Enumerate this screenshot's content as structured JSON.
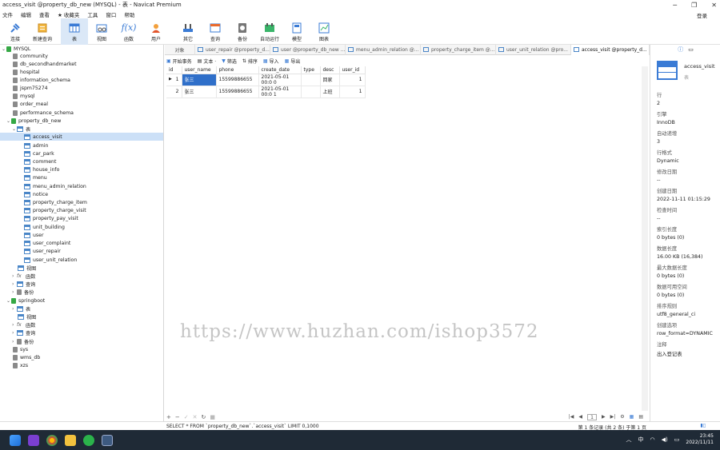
{
  "window": {
    "title": "access_visit @property_db_new (MYSQL) - 表 - Navicat Premium"
  },
  "menubar": {
    "items": [
      "文件",
      "编辑",
      "查看",
      "收藏夹",
      "工具",
      "窗口",
      "帮助"
    ],
    "login": "登录"
  },
  "toolbar": {
    "items": [
      {
        "label": "连接",
        "icon": "plug-icon"
      },
      {
        "label": "新建查询",
        "icon": "new-query-icon"
      },
      {
        "label": "表",
        "icon": "table-icon"
      },
      {
        "label": "视图",
        "icon": "view-icon"
      },
      {
        "label": "函数",
        "icon": "function-icon"
      },
      {
        "label": "用户",
        "icon": "user-icon"
      },
      {
        "label": "其它",
        "icon": "tools-icon"
      },
      {
        "label": "查询",
        "icon": "query-icon"
      },
      {
        "label": "备份",
        "icon": "backup-icon"
      },
      {
        "label": "自动运行",
        "icon": "autorun-icon"
      },
      {
        "label": "模型",
        "icon": "model-icon"
      },
      {
        "label": "图表",
        "icon": "chart-icon"
      }
    ]
  },
  "sidebar": {
    "connection": "MYSQL",
    "databases_top": [
      "community",
      "db_secondhandmarket",
      "hospital",
      "information_schema",
      "jspm75274",
      "mysql",
      "order_meal",
      "performance_schema"
    ],
    "active_db": "property_db_new",
    "tables_group": "表",
    "tables": [
      "access_visit",
      "admin",
      "car_park",
      "comment",
      "house_info",
      "menu",
      "menu_admin_relation",
      "notice",
      "property_charge_item",
      "property_charge_visit",
      "property_pay_visit",
      "unit_building",
      "user",
      "user_complaint",
      "user_repair",
      "user_unit_relation"
    ],
    "db_subgroups": [
      "视图",
      "函数",
      "查询",
      "备份"
    ],
    "second_db": "springboot",
    "second_db_groups": [
      "表",
      "视图",
      "函数",
      "查询",
      "备份"
    ],
    "databases_bottom": [
      "sys",
      "wms_db",
      "xzs"
    ]
  },
  "tabs": {
    "first": "对象",
    "items": [
      "user_repair @property_d...",
      "user @property_db_new ...",
      "menu_admin_relation @...",
      "property_charge_item @...",
      "user_unit_relation @pro...",
      "access_visit @property_d..."
    ]
  },
  "subbar": {
    "items": [
      "开始事务",
      "文本 ·",
      "筛选",
      "排序",
      "导入",
      "导出"
    ]
  },
  "grid": {
    "columns": [
      "id",
      "user_name",
      "phone",
      "create_date",
      "type",
      "desc",
      "user_id"
    ],
    "rows": [
      [
        "1",
        "张三",
        "15599886655",
        "2021-05-01 00:0 0",
        "回家",
        "1"
      ],
      [
        "2",
        "张三",
        "15599886655",
        "2021-05-01 00:0 1",
        "上班",
        "1"
      ]
    ]
  },
  "pager": {
    "page": "1"
  },
  "status": {
    "sql": "SELECT * FROM `property_db_new`.`access_visit` LIMIT 0,1000",
    "records": "第 1 条记录 (共 2 条) 于第 1 页"
  },
  "info": {
    "name": "access_visit",
    "type": "表",
    "props": [
      {
        "k": "行",
        "v": "2"
      },
      {
        "k": "引擎",
        "v": "InnoDB"
      },
      {
        "k": "自动递增",
        "v": "3"
      },
      {
        "k": "行格式",
        "v": "Dynamic"
      },
      {
        "k": "修改日期",
        "v": "--"
      },
      {
        "k": "创建日期",
        "v": "2022-11-11 01:15:29"
      },
      {
        "k": "检查时间",
        "v": "--"
      },
      {
        "k": "索引长度",
        "v": "0 bytes (0)"
      },
      {
        "k": "数据长度",
        "v": "16.00 KB (16,384)"
      },
      {
        "k": "最大数据长度",
        "v": "0 bytes (0)"
      },
      {
        "k": "数据可用空间",
        "v": "0 bytes (0)"
      },
      {
        "k": "排序规则",
        "v": "utf8_general_ci"
      },
      {
        "k": "创建选项",
        "v": "row_format=DYNAMIC"
      },
      {
        "k": "注释",
        "v": "出入登记表"
      }
    ]
  },
  "watermark": "https://www.huzhan.com/ishop3572",
  "taskbar": {
    "ime": "中",
    "time": "23:45",
    "date": "2022/11/11"
  },
  "colors": {
    "accent": "#2f6fc9",
    "db_active": "#35a845",
    "taskbar": "#1f2a36"
  }
}
